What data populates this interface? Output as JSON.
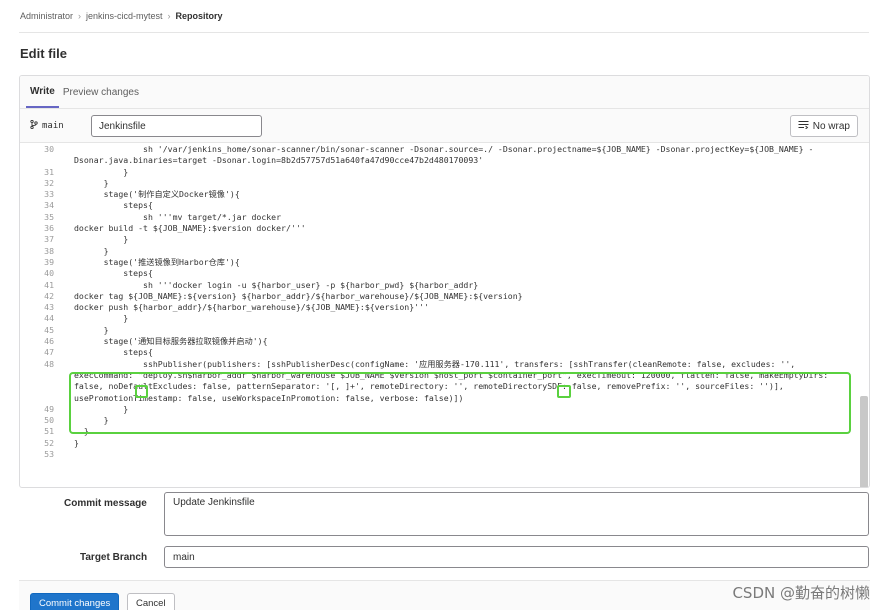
{
  "breadcrumb": [
    "Administrator",
    "jenkins-cicd-mytest",
    "Repository"
  ],
  "page_title": "Edit file",
  "tabs": [
    "Write",
    "Preview changes"
  ],
  "toolbar": {
    "branch": "main",
    "file_name": "Jenkinsfile",
    "wrap_label": "No wrap"
  },
  "code_lines": [
    {
      "n": "30",
      "t": "              sh '/var/jenkins_home/sonar-scanner/bin/sonar-scanner -Dsonar.source=./ -Dsonar.projectname=${JOB_NAME} -Dsonar.projectKey=${JOB_NAME} -Dsonar.java.binaries=target -Dsonar.login=8b2d57757d51a640fa47d90cce47b2d480170093'"
    },
    {
      "n": "31",
      "t": "          }"
    },
    {
      "n": "32",
      "t": "      }"
    },
    {
      "n": "33",
      "t": "      stage('制作自定义Docker镜像'){"
    },
    {
      "n": "34",
      "t": "          steps{"
    },
    {
      "n": "35",
      "t": "              sh '''mv target/*.jar docker"
    },
    {
      "n": "36",
      "t": "docker build -t ${JOB_NAME}:$version docker/'''"
    },
    {
      "n": "37",
      "t": "          }"
    },
    {
      "n": "38",
      "t": "      }"
    },
    {
      "n": "39",
      "t": "      stage('推送镜像到Harbor仓库'){"
    },
    {
      "n": "40",
      "t": "          steps{"
    },
    {
      "n": "41",
      "t": "              sh '''docker login -u ${harbor_user} -p ${harbor_pwd} ${harbor_addr}"
    },
    {
      "n": "42",
      "t": "docker tag ${JOB_NAME}:${version} ${harbor_addr}/${harbor_warehouse}/${JOB_NAME}:${version}"
    },
    {
      "n": "43",
      "t": "docker push ${harbor_addr}/${harbor_warehouse}/${JOB_NAME}:${version}'''"
    },
    {
      "n": "44",
      "t": "          }"
    },
    {
      "n": "45",
      "t": "      }"
    },
    {
      "n": "46",
      "t": "      stage('通知目标服务器拉取镜像并启动'){"
    },
    {
      "n": "47",
      "t": "          steps{"
    },
    {
      "n": "48",
      "t": "              sshPublisher(publishers: [sshPublisherDesc(configName: '应用服务器-170.111', transfers: [sshTransfer(cleanRemote: false, excludes: '', execCommand: \"deploy.sh$harbor_addr $harbor_warehouse $JOB_NAME $version $host_port $container_port\", execTimeout: 120000, flatten: false, makeEmptyDirs: false, noDefaultExcludes: false, patternSeparator: '[, ]+', remoteDirectory: '', remoteDirectorySDF: false, removePrefix: '', sourceFiles: '')], usePromotionTimestamp: false, useWorkspaceInPromotion: false, verbose: false)])"
    },
    {
      "n": "49",
      "t": "          }"
    },
    {
      "n": "50",
      "t": "      }"
    },
    {
      "n": "51",
      "t": "  }"
    },
    {
      "n": "52",
      "t": "}"
    },
    {
      "n": "53",
      "t": ""
    }
  ],
  "form": {
    "commit_label": "Commit message",
    "commit_value": "Update Jenkinsfile",
    "branch_label": "Target Branch",
    "branch_value": "main"
  },
  "buttons": {
    "commit": "Commit changes",
    "cancel": "Cancel"
  },
  "watermark": "CSDN @勤奋的树懒"
}
